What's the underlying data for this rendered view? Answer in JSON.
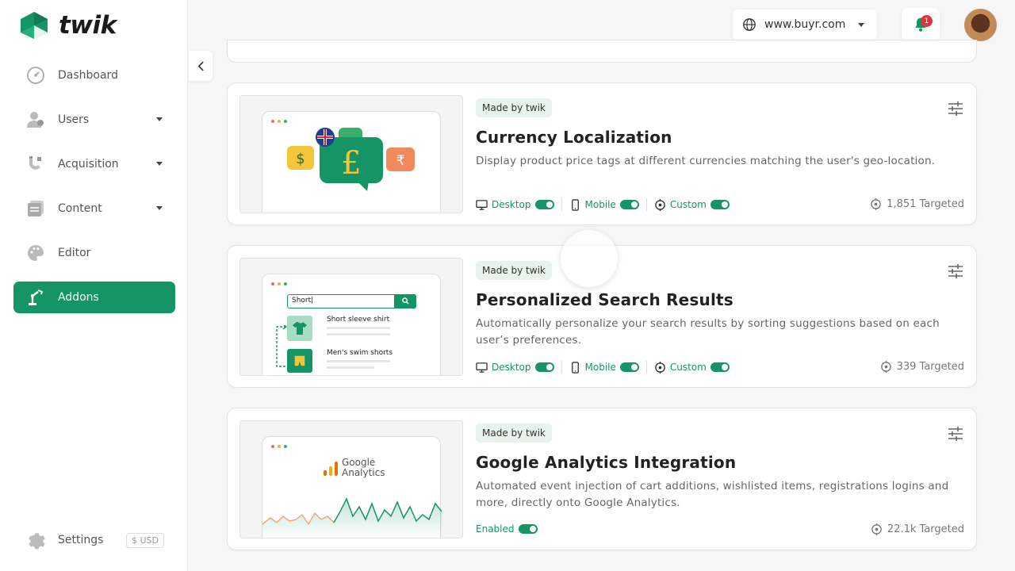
{
  "brand": {
    "name": "twik",
    "color": "#159466"
  },
  "sidebar": {
    "items": [
      {
        "label": "Dashboard",
        "icon": "dashboard-icon",
        "has_caret": false
      },
      {
        "label": "Users",
        "icon": "users-icon",
        "has_caret": true
      },
      {
        "label": "Acquisition",
        "icon": "magnet-icon",
        "has_caret": true
      },
      {
        "label": "Content",
        "icon": "content-icon",
        "has_caret": true
      },
      {
        "label": "Editor",
        "icon": "palette-icon",
        "has_caret": false
      },
      {
        "label": "Addons",
        "icon": "robot-arm-icon",
        "has_caret": false,
        "active": true
      }
    ],
    "settings_label": "Settings",
    "currency": "$ USD"
  },
  "header": {
    "domain": "www.buyr.com",
    "notification_count": "1"
  },
  "cards": [
    {
      "badge": "Made by twik",
      "title": "Currency Localization",
      "description": "Display product price tags at different currencies matching the user's geo-location.",
      "toggles": [
        "Desktop",
        "Mobile",
        "Custom"
      ],
      "targeted": "1,851 Targeted"
    },
    {
      "badge": "Made by twik",
      "title": "Personalized Search Results",
      "description": "Automatically personalize your search results by sorting suggestions based on each user’s preferences.",
      "toggles": [
        "Desktop",
        "Mobile",
        "Custom"
      ],
      "targeted": "339 Targeted",
      "thumb": {
        "search_text": "Short|",
        "item1": "Short sleeve shirt",
        "item2": "Men's swim shorts"
      }
    },
    {
      "badge": "Made by twik",
      "title": "Google Analytics Integration",
      "description": "Automated event injection of cart additions, wishlisted items, registrations logins and more, directly onto Google Analytics.",
      "status": "Enabled",
      "targeted": "22.1k Targeted",
      "thumb": {
        "logo_line1": "Google",
        "logo_line2": "Analytics"
      }
    }
  ]
}
